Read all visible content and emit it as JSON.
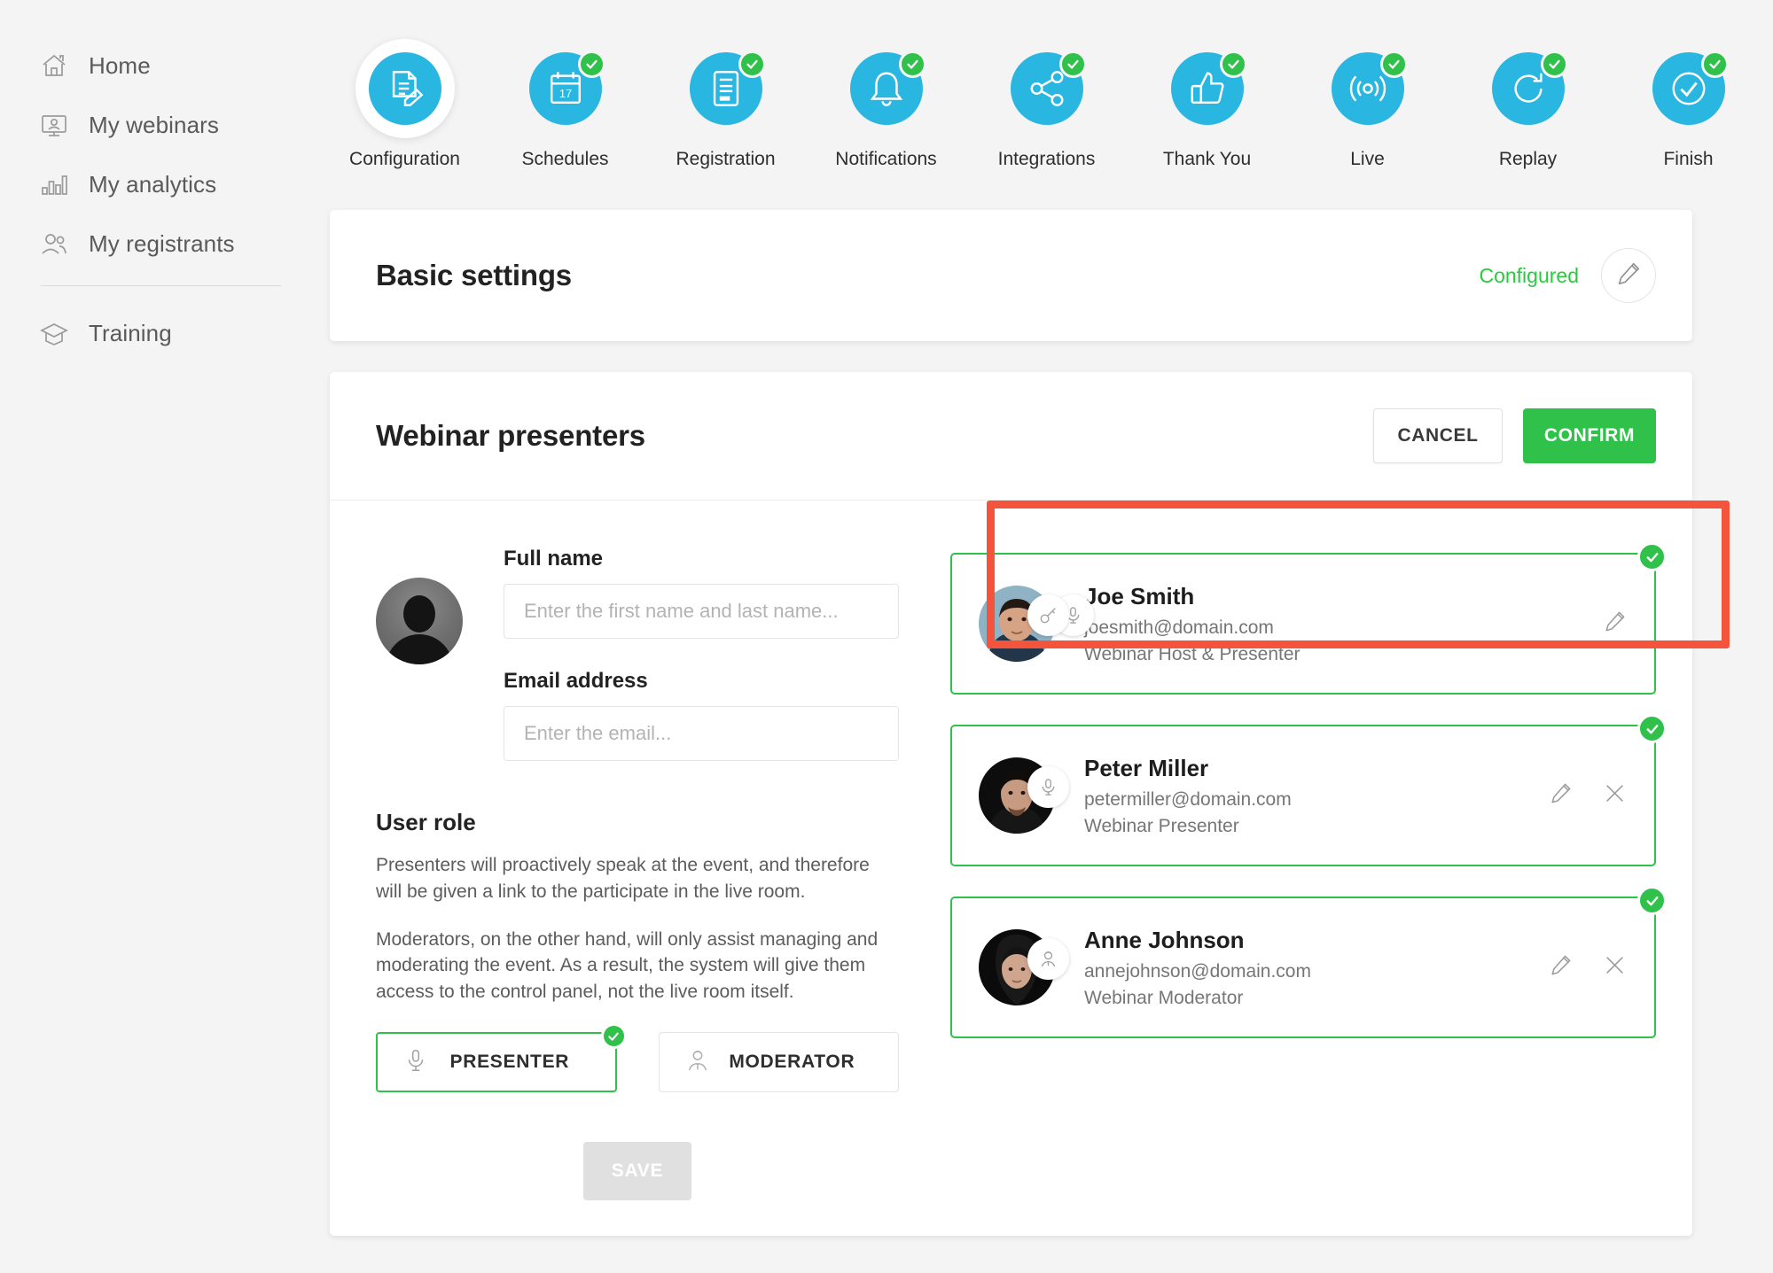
{
  "sidebar": {
    "items": [
      {
        "label": "Home",
        "icon": "home-icon"
      },
      {
        "label": "My webinars",
        "icon": "monitor-presenter-icon"
      },
      {
        "label": "My analytics",
        "icon": "bar-chart-icon"
      },
      {
        "label": "My registrants",
        "icon": "users-icon"
      },
      {
        "label": "Training",
        "icon": "graduation-cap-icon"
      }
    ]
  },
  "stepper": {
    "steps": [
      {
        "label": "Configuration",
        "icon": "document-edit-icon",
        "active": true,
        "completed": false
      },
      {
        "label": "Schedules",
        "icon": "calendar-17-icon",
        "active": false,
        "completed": true
      },
      {
        "label": "Registration",
        "icon": "form-icon",
        "active": false,
        "completed": true
      },
      {
        "label": "Notifications",
        "icon": "bell-icon",
        "active": false,
        "completed": true
      },
      {
        "label": "Integrations",
        "icon": "share-nodes-icon",
        "active": false,
        "completed": true
      },
      {
        "label": "Thank You",
        "icon": "thumbs-up-icon",
        "active": false,
        "completed": true
      },
      {
        "label": "Live",
        "icon": "broadcast-icon",
        "active": false,
        "completed": true
      },
      {
        "label": "Replay",
        "icon": "replay-icon",
        "active": false,
        "completed": true
      },
      {
        "label": "Finish",
        "icon": "check-circle-icon",
        "active": false,
        "completed": true
      }
    ]
  },
  "basic_settings": {
    "title": "Basic settings",
    "status": "Configured",
    "edit_icon": "pencil-icon"
  },
  "presenters_panel": {
    "title": "Webinar presenters",
    "cancel_label": "CANCEL",
    "confirm_label": "CONFIRM",
    "form": {
      "full_name_label": "Full name",
      "full_name_placeholder": "Enter the first name and last name...",
      "full_name_value": "",
      "email_label": "Email address",
      "email_placeholder": "Enter the email...",
      "email_value": "",
      "role_title": "User role",
      "role_paragraph_1": "Presenters will proactively speak at the event, and therefore will be given a link to the participate in the live room.",
      "role_paragraph_2": "Moderators, on the other hand, will only assist managing and moderating the event. As a result, the system will give them access to the control panel, not the live room itself.",
      "role_options": [
        {
          "label": "PRESENTER",
          "icon": "microphone-icon",
          "selected": true
        },
        {
          "label": "MODERATOR",
          "icon": "moderator-person-icon",
          "selected": false
        }
      ],
      "save_label": "SAVE",
      "save_disabled": true
    },
    "list": [
      {
        "name": "Joe Smith",
        "email": "joesmith@domain.com",
        "role": "Webinar Host & Presenter",
        "badges": [
          "key-icon",
          "microphone-icon"
        ],
        "can_edit": true,
        "can_remove": false,
        "confirmed": true,
        "highlighted": true
      },
      {
        "name": "Peter Miller",
        "email": "petermiller@domain.com",
        "role": "Webinar Presenter",
        "badges": [
          "microphone-icon"
        ],
        "can_edit": true,
        "can_remove": true,
        "confirmed": true,
        "highlighted": false
      },
      {
        "name": "Anne Johnson",
        "email": "annejohnson@domain.com",
        "role": "Webinar Moderator",
        "badges": [
          "moderator-person-icon"
        ],
        "can_edit": true,
        "can_remove": true,
        "confirmed": true,
        "highlighted": false
      }
    ]
  },
  "colors": {
    "accent_blue": "#29b6e0",
    "success_green": "#2fc14a",
    "configured_green": "#27cc3c",
    "annotation_red": "#f4543c",
    "page_background": "#f4f4f4"
  },
  "annotation": {
    "shape": "rectangle",
    "color": "#f4543c",
    "target": "Joe Smith presenter card"
  }
}
